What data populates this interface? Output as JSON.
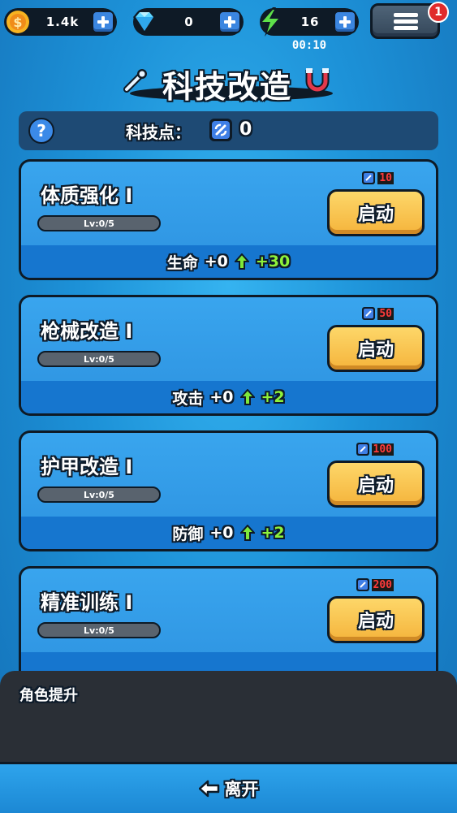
{
  "resources": {
    "coins": "1.4k",
    "gems": "0",
    "energy": "16",
    "timer": "00:10",
    "notification_count": "1"
  },
  "page": {
    "title": "科技改造"
  },
  "tech_points": {
    "label": "科技点：",
    "value": "0",
    "help_label": "?"
  },
  "cards": [
    {
      "name": "体质强化 I",
      "level": "Lv:0/5",
      "cost": "10",
      "button_label": "启动",
      "stat_name": "生命",
      "stat_current": "+0",
      "stat_increase": "+30"
    },
    {
      "name": "枪械改造 I",
      "level": "Lv:0/5",
      "cost": "50",
      "button_label": "启动",
      "stat_name": "攻击",
      "stat_current": "+0",
      "stat_increase": "+2"
    },
    {
      "name": "护甲改造 I",
      "level": "Lv:0/5",
      "cost": "100",
      "button_label": "启动",
      "stat_name": "防御",
      "stat_current": "+0",
      "stat_increase": "+2"
    },
    {
      "name": "精准训练 I",
      "level": "Lv:0/5",
      "cost": "200",
      "button_label": "启动"
    }
  ],
  "bottom_panel": {
    "title": "角色提升"
  },
  "leave_button": {
    "label": "离开"
  },
  "icons": {
    "coin": "coin-icon",
    "gem": "diamond-icon",
    "energy": "lightning-icon",
    "menu": "hamburger-menu-icon",
    "tech_point": "tech-chip-icon",
    "upgrade": "up-arrow-icon",
    "leave": "arrow-left-icon"
  },
  "colors": {
    "background": "#1d92d8",
    "card": "#39a5ee",
    "card_footer": "#1676cf",
    "button": "#f5b43c",
    "stat_increase": "#8ef23a",
    "cost": "#ff3b3b"
  }
}
